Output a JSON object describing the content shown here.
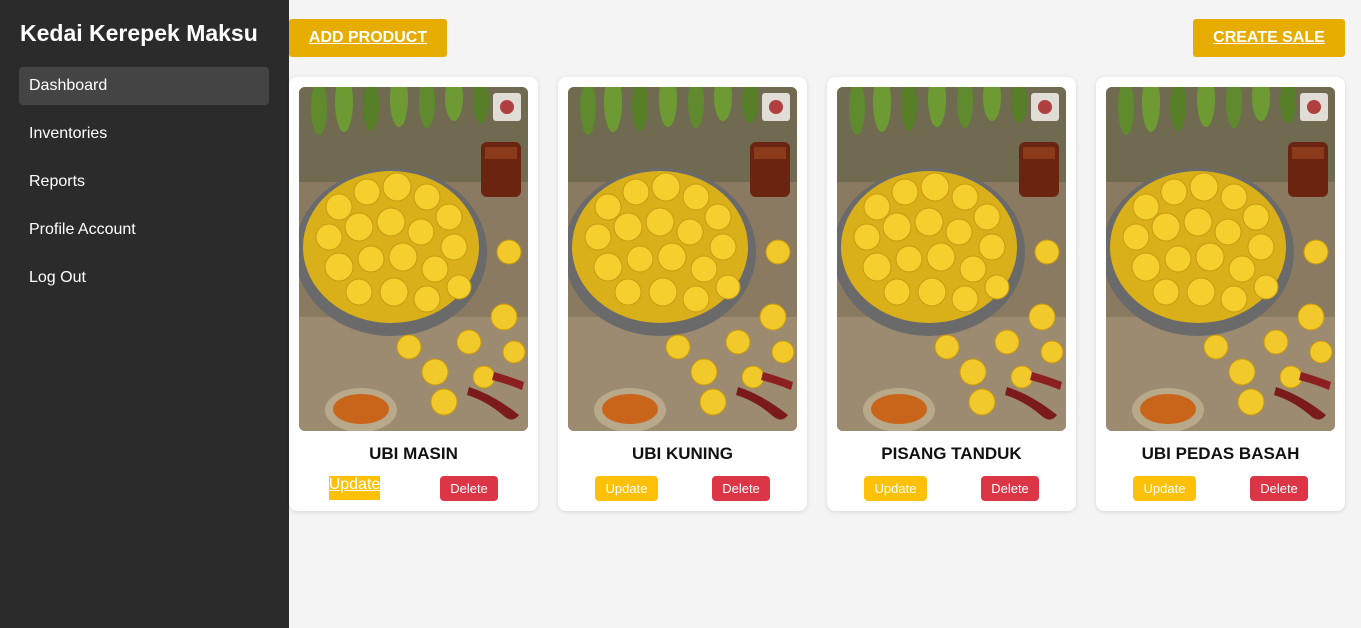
{
  "sidebar": {
    "brand": "Kedai Kerepek Maksu",
    "items": [
      {
        "label": "Dashboard"
      },
      {
        "label": "Inventories"
      },
      {
        "label": "Reports"
      },
      {
        "label": "Profile Account"
      },
      {
        "label": "Log Out"
      }
    ]
  },
  "toolbar": {
    "add_label": "ADD PRODUCT",
    "sale_label": "CREATE SALE"
  },
  "products": [
    {
      "name": "UBI MASIN",
      "update_label": "Update",
      "delete_label": "Delete"
    },
    {
      "name": "UBI KUNING",
      "update_label": "Update",
      "delete_label": "Delete"
    },
    {
      "name": "PISANG TANDUK",
      "update_label": "Update",
      "delete_label": "Delete"
    },
    {
      "name": "UBI PEDAS BASAH",
      "update_label": "Update",
      "delete_label": "Delete"
    }
  ],
  "colors": {
    "sidebar_bg": "#2b2b2b",
    "accent": "#e6ac00",
    "update": "#ffc107",
    "delete": "#dc3545"
  }
}
